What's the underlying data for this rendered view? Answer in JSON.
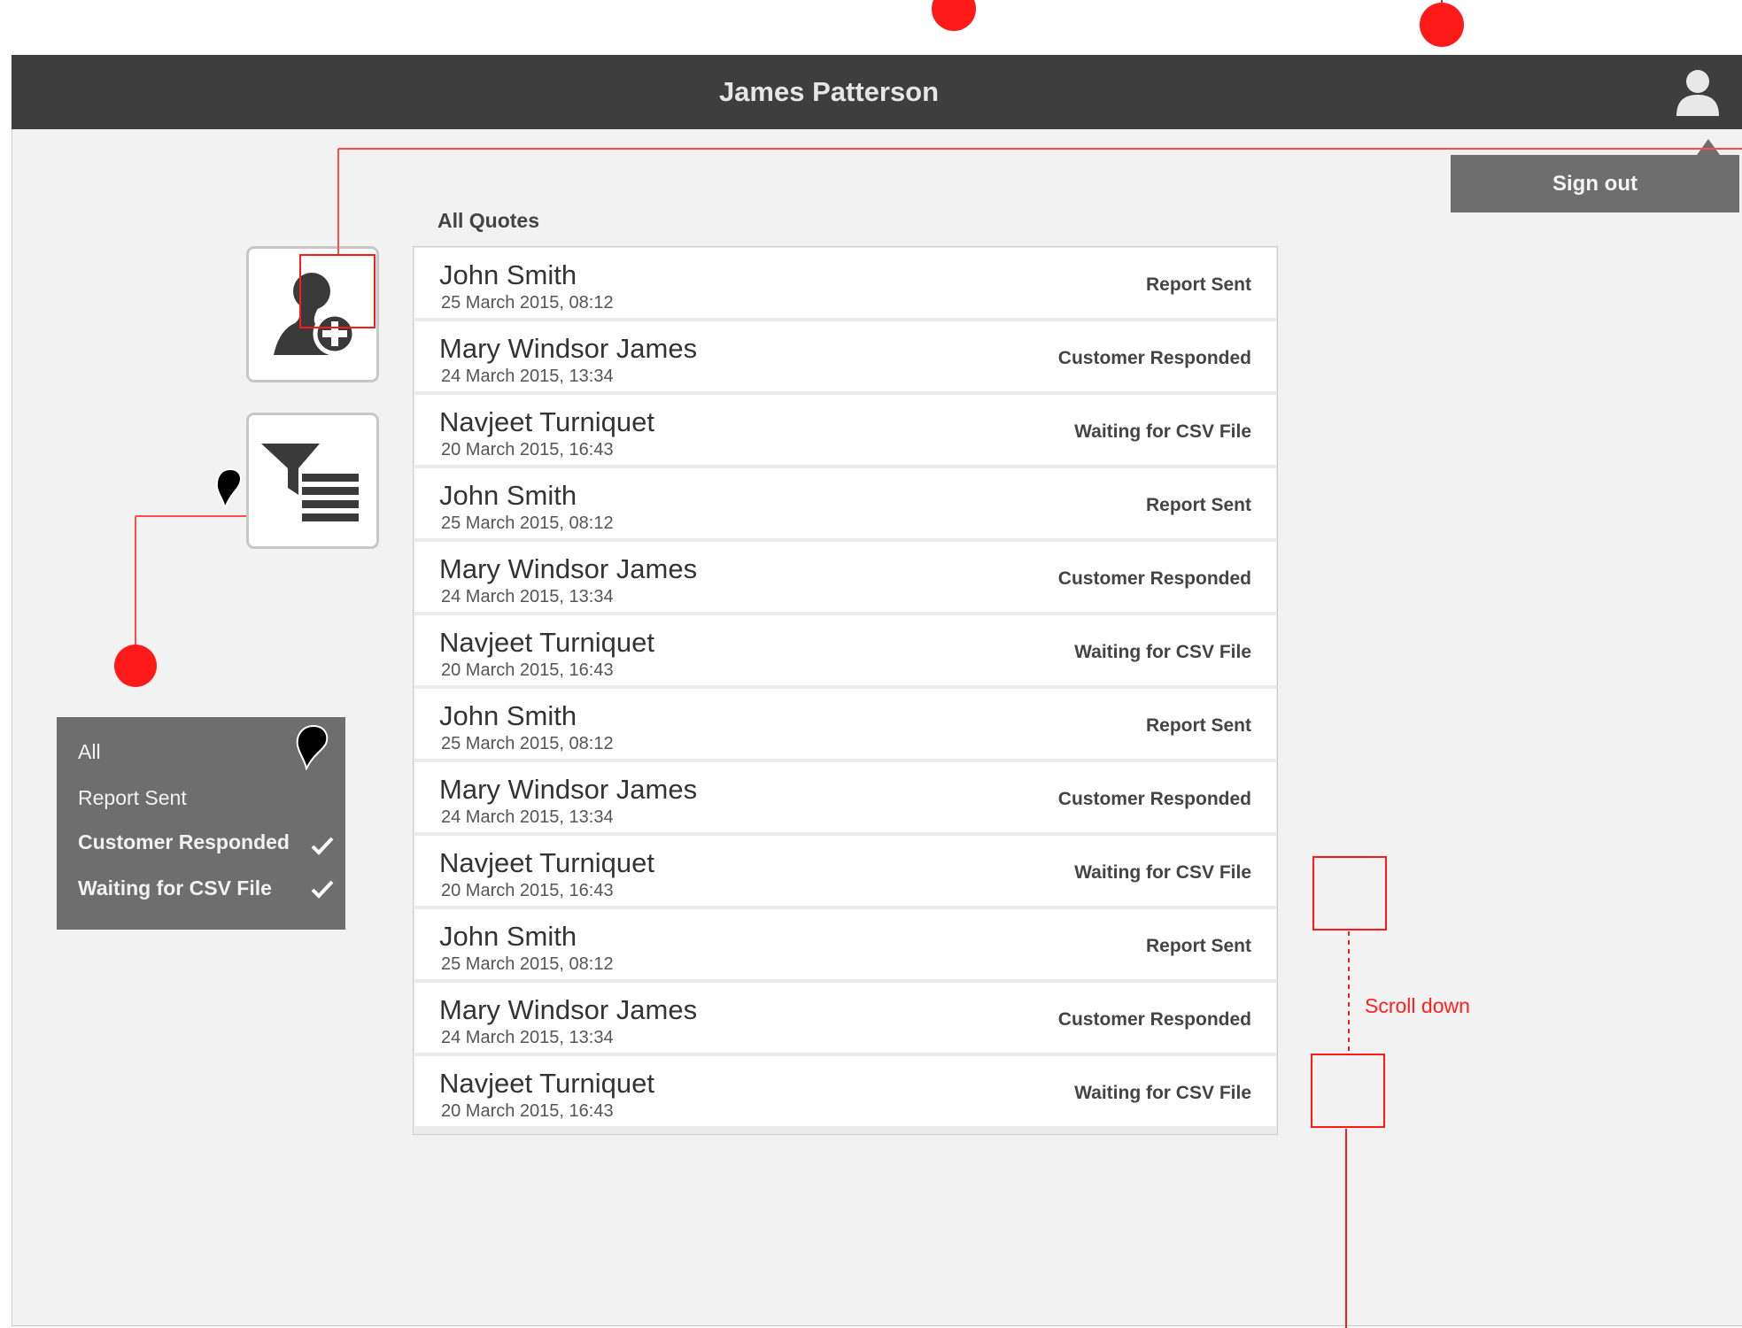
{
  "header": {
    "title": "James Patterson",
    "user_icon": "user-icon"
  },
  "signout": {
    "label": "Sign out"
  },
  "section": {
    "title": "All Quotes"
  },
  "quotes": [
    {
      "name": "John Smith",
      "date": "25 March 2015, 08:12",
      "status": "Report Sent"
    },
    {
      "name": "Mary Windsor James",
      "date": "24 March 2015, 13:34",
      "status": "Customer Responded"
    },
    {
      "name": "Navjeet Turniquet",
      "date": "20 March 2015, 16:43",
      "status": "Waiting for CSV File"
    },
    {
      "name": "John Smith",
      "date": "25 March 2015, 08:12",
      "status": "Report Sent"
    },
    {
      "name": "Mary Windsor James",
      "date": "24 March 2015, 13:34",
      "status": "Customer Responded"
    },
    {
      "name": "Navjeet Turniquet",
      "date": "20 March 2015, 16:43",
      "status": "Waiting for CSV File"
    },
    {
      "name": "John Smith",
      "date": "25 March 2015, 08:12",
      "status": "Report Sent"
    },
    {
      "name": "Mary Windsor James",
      "date": "24 March 2015, 13:34",
      "status": "Customer Responded"
    },
    {
      "name": "Navjeet Turniquet",
      "date": "20 March 2015, 16:43",
      "status": "Waiting for CSV File"
    },
    {
      "name": "John Smith",
      "date": "25 March 2015, 08:12",
      "status": "Report Sent"
    },
    {
      "name": "Mary Windsor James",
      "date": "24 March 2015, 13:34",
      "status": "Customer Responded"
    },
    {
      "name": "Navjeet Turniquet",
      "date": "20 March 2015, 16:43",
      "status": "Waiting for CSV File"
    }
  ],
  "sidebar": {
    "add_customer_icon": "add-user-icon",
    "filter_icon": "filter-list-icon"
  },
  "filter_menu": {
    "items": [
      {
        "label": "All",
        "checked": false
      },
      {
        "label": "Report Sent",
        "checked": false
      },
      {
        "label": "Customer Responded",
        "checked": true
      },
      {
        "label": "Waiting for CSV File",
        "checked": true
      }
    ]
  },
  "annotations": {
    "scroll_label": "Scroll down",
    "color": "#ff2020"
  },
  "colors": {
    "header_bg": "#3e3e3e",
    "menu_bg": "#6e6e6e",
    "annotation": "#ff2020"
  }
}
